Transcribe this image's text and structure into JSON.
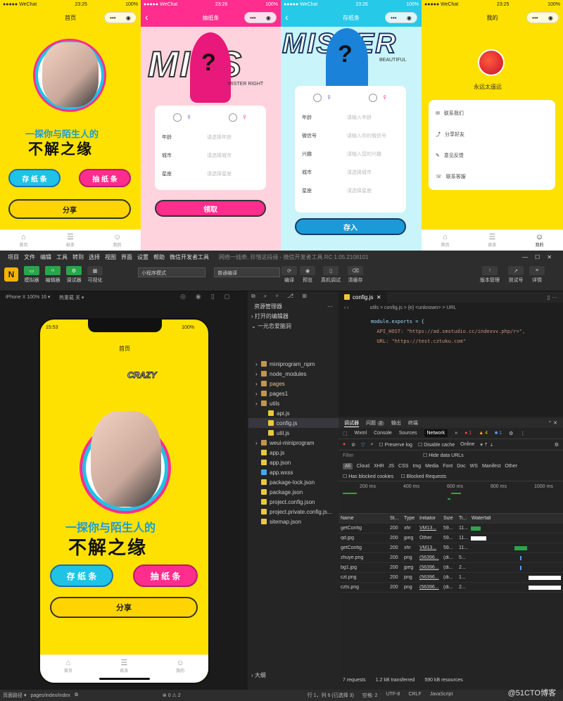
{
  "phones": {
    "home": {
      "carrier": "●●●●● WeChat",
      "time": "23:25",
      "battery": "100%",
      "title": "首页",
      "slogan_line1": "一探你与陌生人的",
      "slogan_line2": "不解之缘",
      "btn_store": "存 纸 条",
      "btn_draw": "抽 纸 条",
      "btn_share": "分享",
      "tabs": [
        "首页",
        "纸条",
        "我的"
      ]
    },
    "draw": {
      "carrier": "●●●●● WeChat",
      "time": "23:26",
      "battery": "100%",
      "title": "抽纸条",
      "big_text": "MISS",
      "sub_text": "MISTER RIGHT",
      "rows": [
        {
          "label": "年龄",
          "placeholder": "请选择年龄"
        },
        {
          "label": "城市",
          "placeholder": "请选择城市"
        },
        {
          "label": "星座",
          "placeholder": "请选择星座"
        }
      ],
      "submit": "领取"
    },
    "store": {
      "carrier": "●●●●● WeChat",
      "time": "23:26",
      "battery": "100%",
      "title": "存纸条",
      "big_text": "MISTER",
      "sub_text": "BEAUTIFUL",
      "rows": [
        {
          "label": "年龄",
          "placeholder": "请输入年龄"
        },
        {
          "label": "微信号",
          "placeholder": "请输入你的微信号"
        },
        {
          "label": "兴趣",
          "placeholder": "请输入您的兴趣"
        },
        {
          "label": "城市",
          "placeholder": "请选择城市"
        },
        {
          "label": "星座",
          "placeholder": "请选择星座"
        }
      ],
      "submit": "存入"
    },
    "mine": {
      "carrier": "●●●●● WeChat",
      "time": "23:25",
      "battery": "100%",
      "title": "我的",
      "username": "永远太遥远",
      "menu": [
        "联系我们",
        "分享好友",
        "意见反馈",
        "联系客服"
      ],
      "tabs": [
        "首页",
        "纸条",
        "我的"
      ]
    }
  },
  "ide": {
    "menu": [
      "项目",
      "文件",
      "编辑",
      "工具",
      "转到",
      "选择",
      "视图",
      "界面",
      "设置",
      "帮助",
      "微信开发者工具"
    ],
    "window_title": "网络一线牵, 珍惜这段缘 - 微信开发者工具 RC 1.05.2108101",
    "toolbar_left": [
      "模拟器",
      "编辑器",
      "调试器",
      "可视化"
    ],
    "mode_select": "小程序模式",
    "compile_select": "普通编译",
    "toolbar_mid": [
      "编译",
      "预览",
      "真机调试",
      "清缓存"
    ],
    "toolbar_right": [
      "版本管理",
      "测试号",
      "详情"
    ],
    "device_select": "iPhone X 100% 16 ▾",
    "hotreload": "热重载 关 ▾",
    "sim": {
      "time": "15:53",
      "battery": "100%",
      "title": "首页",
      "crazy": "CRAZY",
      "slogan_line1": "一探你与陌生人的",
      "slogan_line2": "不解之缘",
      "btn_store": "存 纸 条",
      "btn_draw": "抽 纸 条",
      "btn_share": "分享",
      "tabs": [
        "首页",
        "纸条",
        "我的"
      ]
    },
    "explorer_title": "资源管理器",
    "open_editors": "打开的编辑器",
    "project_root": "一元恋爱脑洞",
    "tree": [
      {
        "name": "miniprogram_npm",
        "kind": "folder",
        "depth": 1
      },
      {
        "name": "node_modules",
        "kind": "folder",
        "depth": 1
      },
      {
        "name": "pages",
        "kind": "folder",
        "depth": 1
      },
      {
        "name": "pages1",
        "kind": "folder",
        "depth": 1
      },
      {
        "name": "utils",
        "kind": "folder",
        "depth": 1
      },
      {
        "name": "api.js",
        "kind": "js",
        "depth": 2
      },
      {
        "name": "config.js",
        "kind": "js",
        "depth": 2
      },
      {
        "name": "util.js",
        "kind": "js",
        "depth": 2
      },
      {
        "name": "weui-miniprogram",
        "kind": "folder",
        "depth": 1
      },
      {
        "name": "app.js",
        "kind": "js",
        "depth": 1
      },
      {
        "name": "app.json",
        "kind": "json",
        "depth": 1
      },
      {
        "name": "app.wxss",
        "kind": "wxss",
        "depth": 1
      },
      {
        "name": "package-lock.json",
        "kind": "json",
        "depth": 1
      },
      {
        "name": "package.json",
        "kind": "json",
        "depth": 1
      },
      {
        "name": "project.config.json",
        "kind": "json",
        "depth": 1
      },
      {
        "name": "project.private.config.js...",
        "kind": "json",
        "depth": 1
      },
      {
        "name": "sitemap.json",
        "kind": "json",
        "depth": 1
      }
    ],
    "outline": "大纲",
    "status_left": "⊗ 0 ⚠ 2",
    "editor_tab": "config.js",
    "breadcrumb": "utils > config.js > {e} <unknown> > URL",
    "code_lines": [
      "module.exports = {",
      "  API_HOST: \"https://ad.smstudio.cc/indexvv.php/r=\",",
      "  URL: \"https://test.cztuku.com\""
    ],
    "devtools_tabs": [
      "调试器",
      "问题",
      "输出",
      "终端"
    ],
    "devtools_issue_count": "2",
    "panel_tabs": [
      "Wxml",
      "Console",
      "Sources",
      "Network"
    ],
    "network_counts": {
      "errors": "1",
      "warnings": "4",
      "info": "1"
    },
    "preserve_log": "Preserve log",
    "disable_cache": "Disable cache",
    "throttle": "Online",
    "filter_placeholder": "Filter",
    "hide_data_urls": "Hide data URLs",
    "type_filters": [
      "All",
      "Cloud",
      "XHR",
      "JS",
      "CSS",
      "Img",
      "Media",
      "Font",
      "Doc",
      "WS",
      "Manifest",
      "Other"
    ],
    "blocked_cookies": "Has blocked cookies",
    "blocked_requests": "Blocked Requests",
    "timeline_ticks": [
      "200 ms",
      "400 ms",
      "600 ms",
      "800 ms",
      "1000 ms"
    ],
    "columns": [
      "Name",
      "St...",
      "Type",
      "Initiator",
      "Size",
      "Ti...",
      "Waterfall"
    ],
    "requests": [
      {
        "name": "getConfig",
        "status": "200",
        "type": "xhr",
        "initiator": "VM13...",
        "size": "59...",
        "time": "11..."
      },
      {
        "name": "qd.jpg",
        "status": "200",
        "type": "jpeg",
        "initiator": "Other",
        "size": "59...",
        "time": "11..."
      },
      {
        "name": "getConfig",
        "status": "200",
        "type": "xhr",
        "initiator": "VM13...",
        "size": "59...",
        "time": "11..."
      },
      {
        "name": "zhuye.png",
        "status": "200",
        "type": "png",
        "initiator": "(56396...",
        "size": "(di...",
        "time": "5..."
      },
      {
        "name": "bg1.jpg",
        "status": "200",
        "type": "jpeg",
        "initiator": "(56396...",
        "size": "(di...",
        "time": "2..."
      },
      {
        "name": "czt.png",
        "status": "200",
        "type": "png",
        "initiator": "(56396...",
        "size": "(di...",
        "time": "1..."
      },
      {
        "name": "czts.png",
        "status": "200",
        "type": "png",
        "initiator": "(56396...",
        "size": "(di...",
        "time": "2..."
      }
    ],
    "net_summary": [
      "7 requests",
      "1.2 kB transferred",
      "590 kB resources"
    ],
    "page_path_label": "页面路径 ▾",
    "page_path": "pages/index/index",
    "status_right": [
      "行 1，列 6 (已选择 3)",
      "空格: 2",
      "UTF-8",
      "CRLF",
      "JavaScript"
    ],
    "watermark": "@51CTO博客"
  },
  "colors": {
    "yellow": "#ffe100",
    "pink": "#ff2d8d",
    "cyan": "#26c9e8",
    "devtools_blue": "#1a73e8"
  }
}
